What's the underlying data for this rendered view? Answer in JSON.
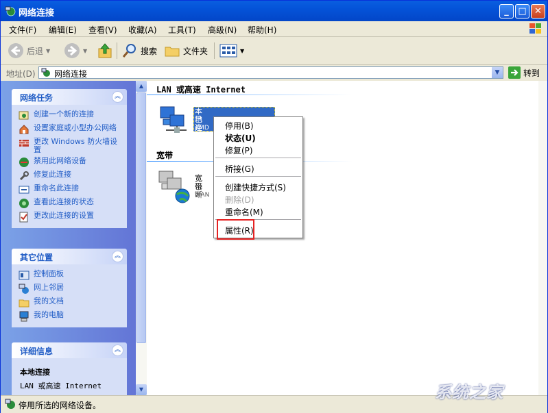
{
  "window": {
    "title": "网络连接"
  },
  "menubar": {
    "items": [
      "文件(F)",
      "编辑(E)",
      "查看(V)",
      "收藏(A)",
      "工具(T)",
      "高级(N)",
      "帮助(H)"
    ]
  },
  "toolbar": {
    "back": "后退",
    "search": "搜索",
    "folders": "文件夹"
  },
  "address": {
    "label": "地址(D)",
    "value": "网络连接",
    "go": "转到"
  },
  "tasks": {
    "network": {
      "title": "网络任务",
      "items": [
        "创建一个新的连接",
        "设置家庭或小型办公网络",
        "更改 Windows 防火墙设置",
        "禁用此网络设备",
        "修复此连接",
        "重命名此连接",
        "查看此连接的状态",
        "更改此连接的设置"
      ]
    },
    "other": {
      "title": "其它位置",
      "items": [
        "控制面板",
        "网上邻居",
        "我的文档",
        "我的电脑"
      ]
    },
    "details": {
      "title": "详细信息",
      "name": "本地连接",
      "type": "LAN 或高速 Internet"
    }
  },
  "content": {
    "group_lan": "LAN 或高速 Internet",
    "group_broadband": "宽带",
    "lan": {
      "name": "本地连接",
      "status": "已连",
      "device": "AMD"
    },
    "wan": {
      "name": "宽带",
      "status": "已断",
      "device": "WAN"
    }
  },
  "context_menu": {
    "items": [
      {
        "label": "停用(B)",
        "enabled": true,
        "bold": false
      },
      {
        "label": "状态(U)",
        "enabled": true,
        "bold": true
      },
      {
        "label": "修复(P)",
        "enabled": true,
        "bold": false
      },
      {
        "label": "桥接(G)",
        "enabled": true,
        "bold": false
      },
      {
        "label": "创建快捷方式(S)",
        "enabled": true,
        "bold": false
      },
      {
        "label": "删除(D)",
        "enabled": false,
        "bold": false
      },
      {
        "label": "重命名(M)",
        "enabled": true,
        "bold": false
      },
      {
        "label": "属性(R)",
        "enabled": true,
        "bold": false,
        "highlighted": true
      }
    ]
  },
  "status": {
    "text": "停用所选的网络设备。"
  },
  "watermark": "系统之家"
}
